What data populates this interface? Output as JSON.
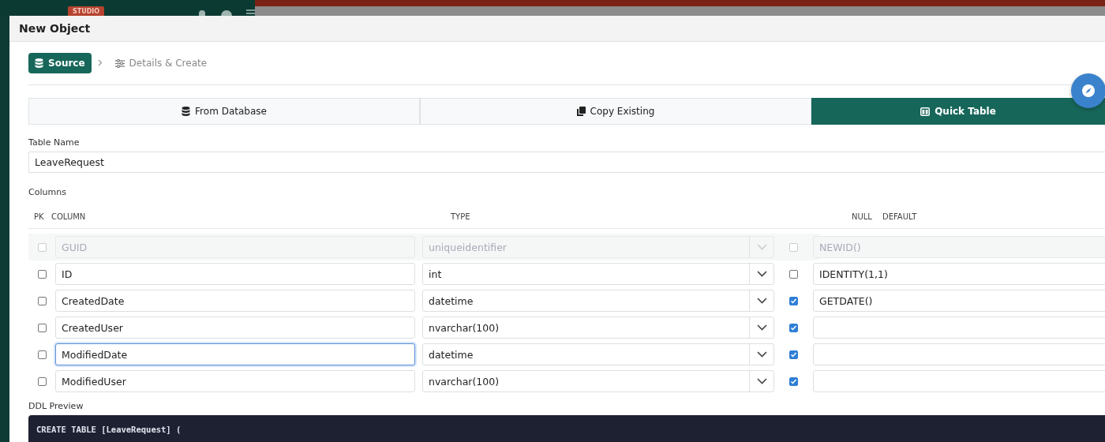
{
  "app_header": {
    "badge": "STUDIO"
  },
  "dialog": {
    "title": "New Object"
  },
  "steps": [
    {
      "label": "Source",
      "selected": true
    },
    {
      "label": "Details & Create",
      "selected": false
    }
  ],
  "source_tabs": [
    {
      "label": "From Database",
      "selected": false,
      "kind": "database"
    },
    {
      "label": "Copy Existing",
      "selected": false,
      "kind": "copy"
    },
    {
      "label": "Quick Table",
      "selected": true,
      "kind": "table"
    }
  ],
  "table_name": {
    "label": "Table Name",
    "value": "LeaveRequest"
  },
  "columns": {
    "label": "Columns",
    "headers": [
      "PK",
      "COLUMN",
      "TYPE",
      "NULL",
      "DEFAULT"
    ],
    "rows": [
      {
        "pk": false,
        "name": "GUID",
        "type": "uniqueidentifier",
        "null": false,
        "default": "NEWID()",
        "disabled": true,
        "focused": false
      },
      {
        "pk": false,
        "name": "ID",
        "type": "int",
        "null": false,
        "default": "IDENTITY(1,1)",
        "disabled": false,
        "focused": false
      },
      {
        "pk": false,
        "name": "CreatedDate",
        "type": "datetime",
        "null": true,
        "default": "GETDATE()",
        "disabled": false,
        "focused": false
      },
      {
        "pk": false,
        "name": "CreatedUser",
        "type": "nvarchar(100)",
        "null": true,
        "disabled": false,
        "focused": false
      },
      {
        "pk": false,
        "name": "ModifiedDate",
        "type": "datetime",
        "null": true,
        "disabled": false,
        "focused": true
      },
      {
        "pk": false,
        "name": "ModifiedUser",
        "type": "nvarchar(100)",
        "null": true,
        "disabled": false,
        "focused": false
      }
    ]
  },
  "ddl_preview": {
    "label": "DDL Preview",
    "code": [
      "CREATE TABLE [LeaveRequest] ("
    ]
  }
}
